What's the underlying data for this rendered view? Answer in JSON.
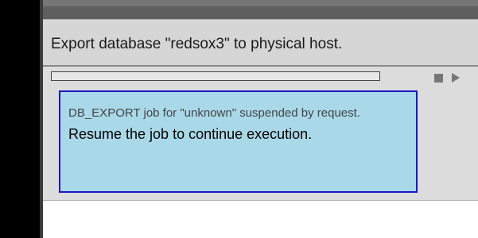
{
  "job": {
    "title": "Export database \"redsox3\" to physical host.",
    "progress": 0
  },
  "message": {
    "part1": "DB_EXPORT job for \"unknown\" suspended by request.",
    "part2": "Resume the job to continue execution."
  },
  "controls": {
    "stop_icon": "stop-icon",
    "play_icon": "play-icon"
  },
  "colors": {
    "message_bg": "#a9d9e8",
    "message_border": "#1818c8"
  }
}
